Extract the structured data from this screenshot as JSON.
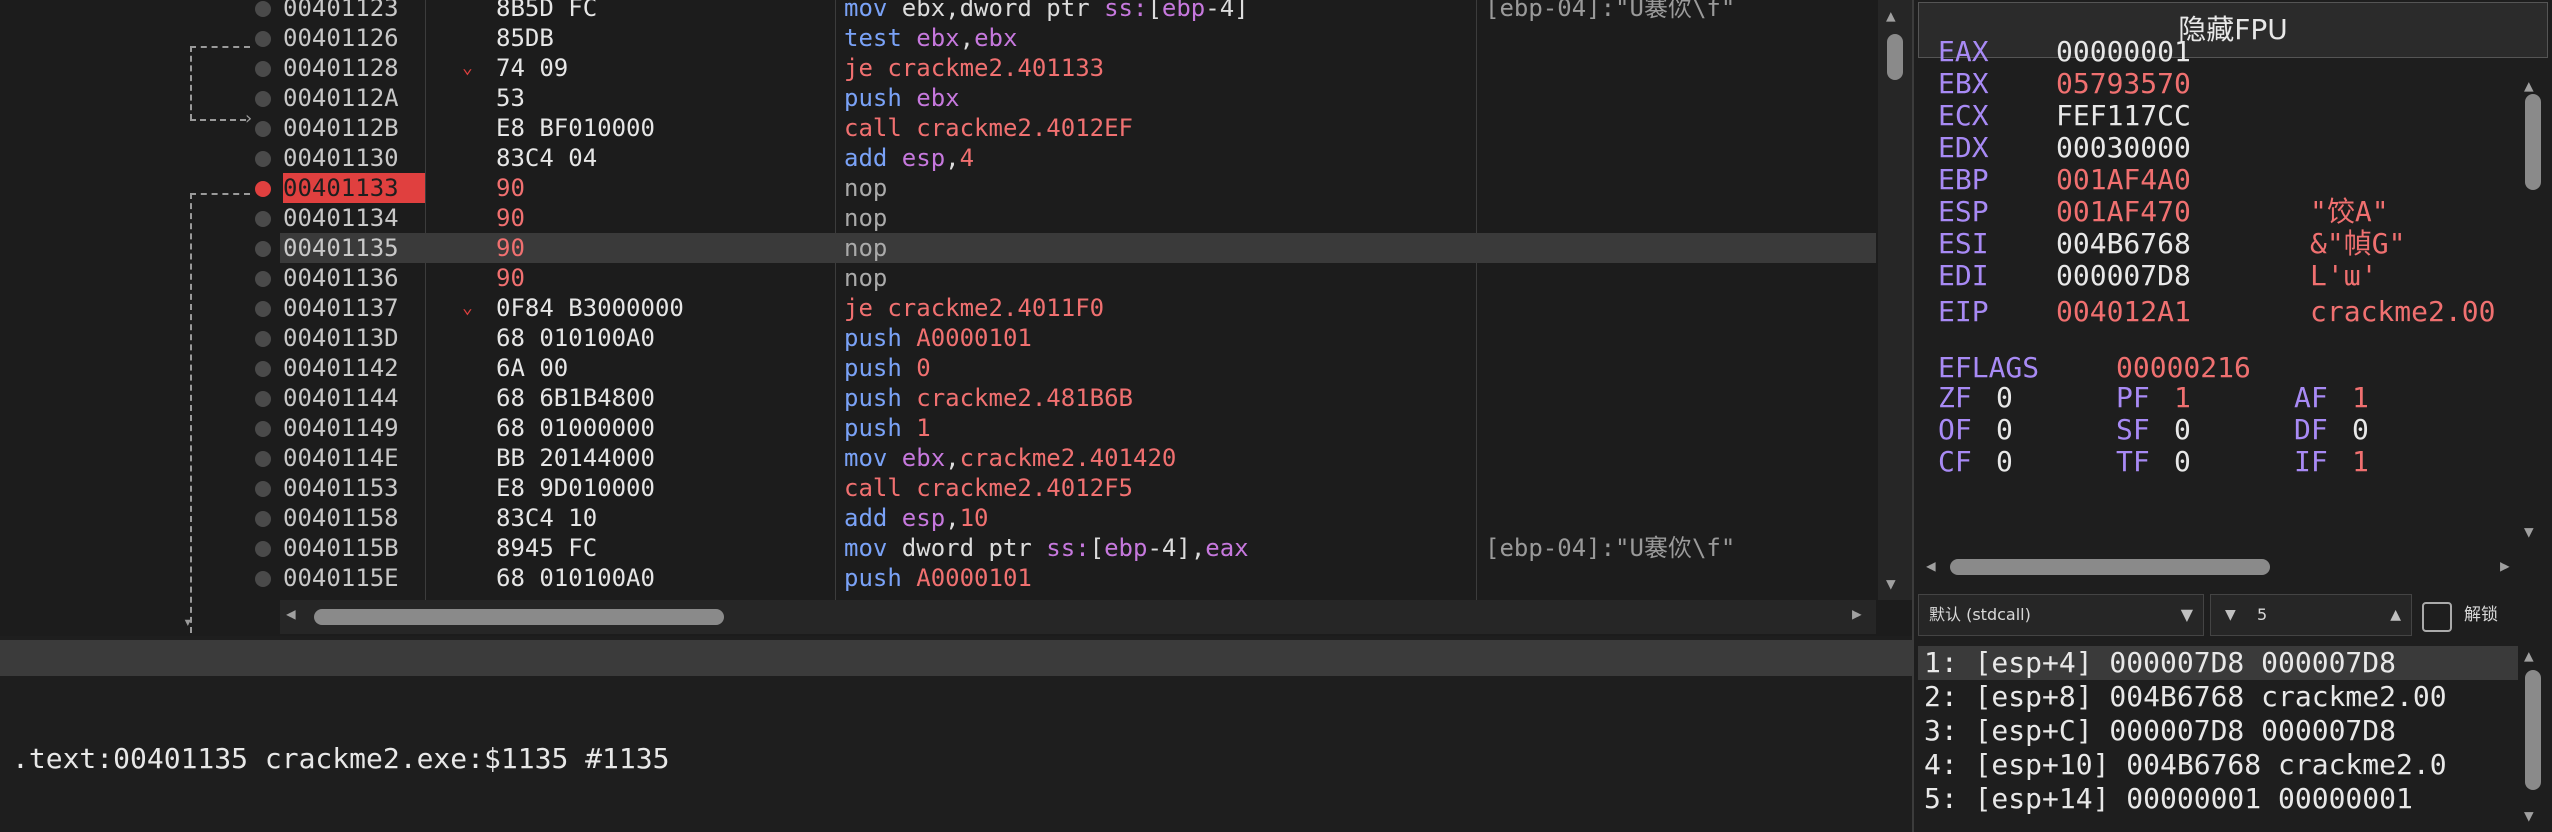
{
  "disasm": {
    "rows": [
      {
        "addr": "00401123",
        "bytes": "8B5D FC",
        "asm": [
          [
            "k-blue",
            "mov "
          ],
          [
            "k-white",
            "ebx,"
          ],
          [
            "k-white",
            "dword ptr "
          ],
          [
            "k-mag",
            "ss:"
          ],
          [
            "k-white",
            "["
          ],
          [
            "k-mag",
            "ebp"
          ],
          [
            "k-white",
            "-4]"
          ]
        ],
        "cmt": "[ebp-04]:\"U褰佽\\f\""
      },
      {
        "addr": "00401126",
        "bytes": "85DB",
        "asm": [
          [
            "k-blue",
            "test "
          ],
          [
            "k-mag",
            "ebx"
          ],
          [
            "k-white",
            ","
          ],
          [
            "k-mag",
            "ebx"
          ]
        ],
        "cmt": ""
      },
      {
        "addr": "00401128",
        "bytes": "74 09",
        "asm": [
          [
            "k-red",
            "je crackme2.401133"
          ]
        ],
        "cmt": "",
        "jmp": "⌄"
      },
      {
        "addr": "0040112A",
        "bytes": "53",
        "asm": [
          [
            "k-blue",
            "push "
          ],
          [
            "k-mag",
            "ebx"
          ]
        ],
        "cmt": ""
      },
      {
        "addr": "0040112B",
        "bytes": "E8 BF010000",
        "asm": [
          [
            "k-red",
            "call crackme2.4012EF"
          ]
        ],
        "cmt": ""
      },
      {
        "addr": "00401130",
        "bytes": "83C4 04",
        "asm": [
          [
            "k-blue",
            "add "
          ],
          [
            "k-mag",
            "esp"
          ],
          [
            "k-white",
            ","
          ],
          [
            "k-red",
            "4"
          ]
        ],
        "cmt": ""
      },
      {
        "addr": "00401133",
        "bytes": "90",
        "asm": [
          [
            "k-gray",
            "nop"
          ]
        ],
        "cmt": "",
        "bp": true,
        "redbytes": true
      },
      {
        "addr": "00401134",
        "bytes": "90",
        "asm": [
          [
            "k-gray",
            "nop"
          ]
        ],
        "cmt": "",
        "redbytes": true
      },
      {
        "addr": "00401135",
        "bytes": "90",
        "asm": [
          [
            "k-gray",
            "nop"
          ]
        ],
        "cmt": "",
        "cur": true,
        "redbytes": true
      },
      {
        "addr": "00401136",
        "bytes": "90",
        "asm": [
          [
            "k-gray",
            "nop"
          ]
        ],
        "cmt": "",
        "redbytes": true
      },
      {
        "addr": "00401137",
        "bytes": "0F84 B3000000",
        "asm": [
          [
            "k-red",
            "je crackme2.4011F0"
          ]
        ],
        "cmt": "",
        "jmp": "⌄"
      },
      {
        "addr": "0040113D",
        "bytes": "68 010100A0",
        "asm": [
          [
            "k-blue",
            "push "
          ],
          [
            "k-red",
            "A0000101"
          ]
        ],
        "cmt": ""
      },
      {
        "addr": "00401142",
        "bytes": "6A 00",
        "asm": [
          [
            "k-blue",
            "push "
          ],
          [
            "k-red",
            "0"
          ]
        ],
        "cmt": ""
      },
      {
        "addr": "00401144",
        "bytes": "68 6B1B4800",
        "asm": [
          [
            "k-blue",
            "push "
          ],
          [
            "k-red",
            "crackme2.481B6B"
          ]
        ],
        "cmt": ""
      },
      {
        "addr": "00401149",
        "bytes": "68 01000000",
        "asm": [
          [
            "k-blue",
            "push "
          ],
          [
            "k-red",
            "1"
          ]
        ],
        "cmt": ""
      },
      {
        "addr": "0040114E",
        "bytes": "BB 20144000",
        "asm": [
          [
            "k-blue",
            "mov "
          ],
          [
            "k-mag",
            "ebx"
          ],
          [
            "k-white",
            ","
          ],
          [
            "k-red",
            "crackme2.401420"
          ]
        ],
        "cmt": ""
      },
      {
        "addr": "00401153",
        "bytes": "E8 9D010000",
        "asm": [
          [
            "k-red",
            "call crackme2.4012F5"
          ]
        ],
        "cmt": ""
      },
      {
        "addr": "00401158",
        "bytes": "83C4 10",
        "asm": [
          [
            "k-blue",
            "add "
          ],
          [
            "k-mag",
            "esp"
          ],
          [
            "k-white",
            ","
          ],
          [
            "k-red",
            "10"
          ]
        ],
        "cmt": ""
      },
      {
        "addr": "0040115B",
        "bytes": "8945 FC",
        "asm": [
          [
            "k-blue",
            "mov "
          ],
          [
            "k-white",
            "dword ptr "
          ],
          [
            "k-mag",
            "ss:"
          ],
          [
            "k-white",
            "["
          ],
          [
            "k-mag",
            "ebp"
          ],
          [
            "k-white",
            "-4],"
          ],
          [
            "k-mag",
            "eax"
          ]
        ],
        "cmt": "[ebp-04]:\"U褰佽\\f\""
      },
      {
        "addr": "0040115E",
        "bytes": "68 010100A0",
        "asm": [
          [
            "k-blue",
            "push "
          ],
          [
            "k-red",
            "A0000101"
          ]
        ],
        "cmt": ""
      }
    ]
  },
  "info": {
    "text": ".text:00401135 crackme2.exe:$1135 #1135"
  },
  "registers": {
    "fpu_button": "隐藏FPU",
    "gp": [
      {
        "name": "EAX",
        "value": "00000001",
        "red": false,
        "cmt": ""
      },
      {
        "name": "EBX",
        "value": "05793570",
        "red": true,
        "cmt": ""
      },
      {
        "name": "ECX",
        "value": "FEF117CC",
        "red": false,
        "cmt": ""
      },
      {
        "name": "EDX",
        "value": "00030000",
        "red": false,
        "cmt": ""
      },
      {
        "name": "EBP",
        "value": "001AF4A0",
        "red": true,
        "cmt": ""
      },
      {
        "name": "ESP",
        "value": "001AF470",
        "red": true,
        "cmt": "\"饺A\""
      },
      {
        "name": "ESI",
        "value": "004B6768",
        "red": false,
        "cmt": "&\"幀G\""
      },
      {
        "name": "EDI",
        "value": "000007D8",
        "red": false,
        "cmt": "L'ɯ'"
      }
    ],
    "eip": {
      "name": "EIP",
      "value": "004012A1",
      "cmt": "crackme2.00"
    },
    "eflags": {
      "name": "EFLAGS",
      "value": "00000216"
    },
    "flags": [
      [
        {
          "n": "ZF",
          "v": "0"
        },
        {
          "n": "PF",
          "v": "1"
        },
        {
          "n": "AF",
          "v": "1"
        }
      ],
      [
        {
          "n": "OF",
          "v": "0"
        },
        {
          "n": "SF",
          "v": "0"
        },
        {
          "n": "DF",
          "v": "0"
        }
      ],
      [
        {
          "n": "CF",
          "v": "0"
        },
        {
          "n": "TF",
          "v": "0"
        },
        {
          "n": "IF",
          "v": "1"
        }
      ]
    ]
  },
  "controls": {
    "convention": "默认 (stdcall)",
    "count": "5",
    "lock_label": "解锁"
  },
  "stack": {
    "rows": [
      "1: [esp+4] 000007D8 000007D8",
      "2: [esp+8] 004B6768 crackme2.00",
      "3: [esp+C] 000007D8 000007D8",
      "4: [esp+10] 004B6768 crackme2.0",
      "5: [esp+14] 00000001 00000001"
    ]
  },
  "colors": {
    "breakpoint": "#e0403f",
    "register_name": "#a88af5",
    "modified": "#f07070",
    "mnemonic": "#7aa2f7"
  }
}
